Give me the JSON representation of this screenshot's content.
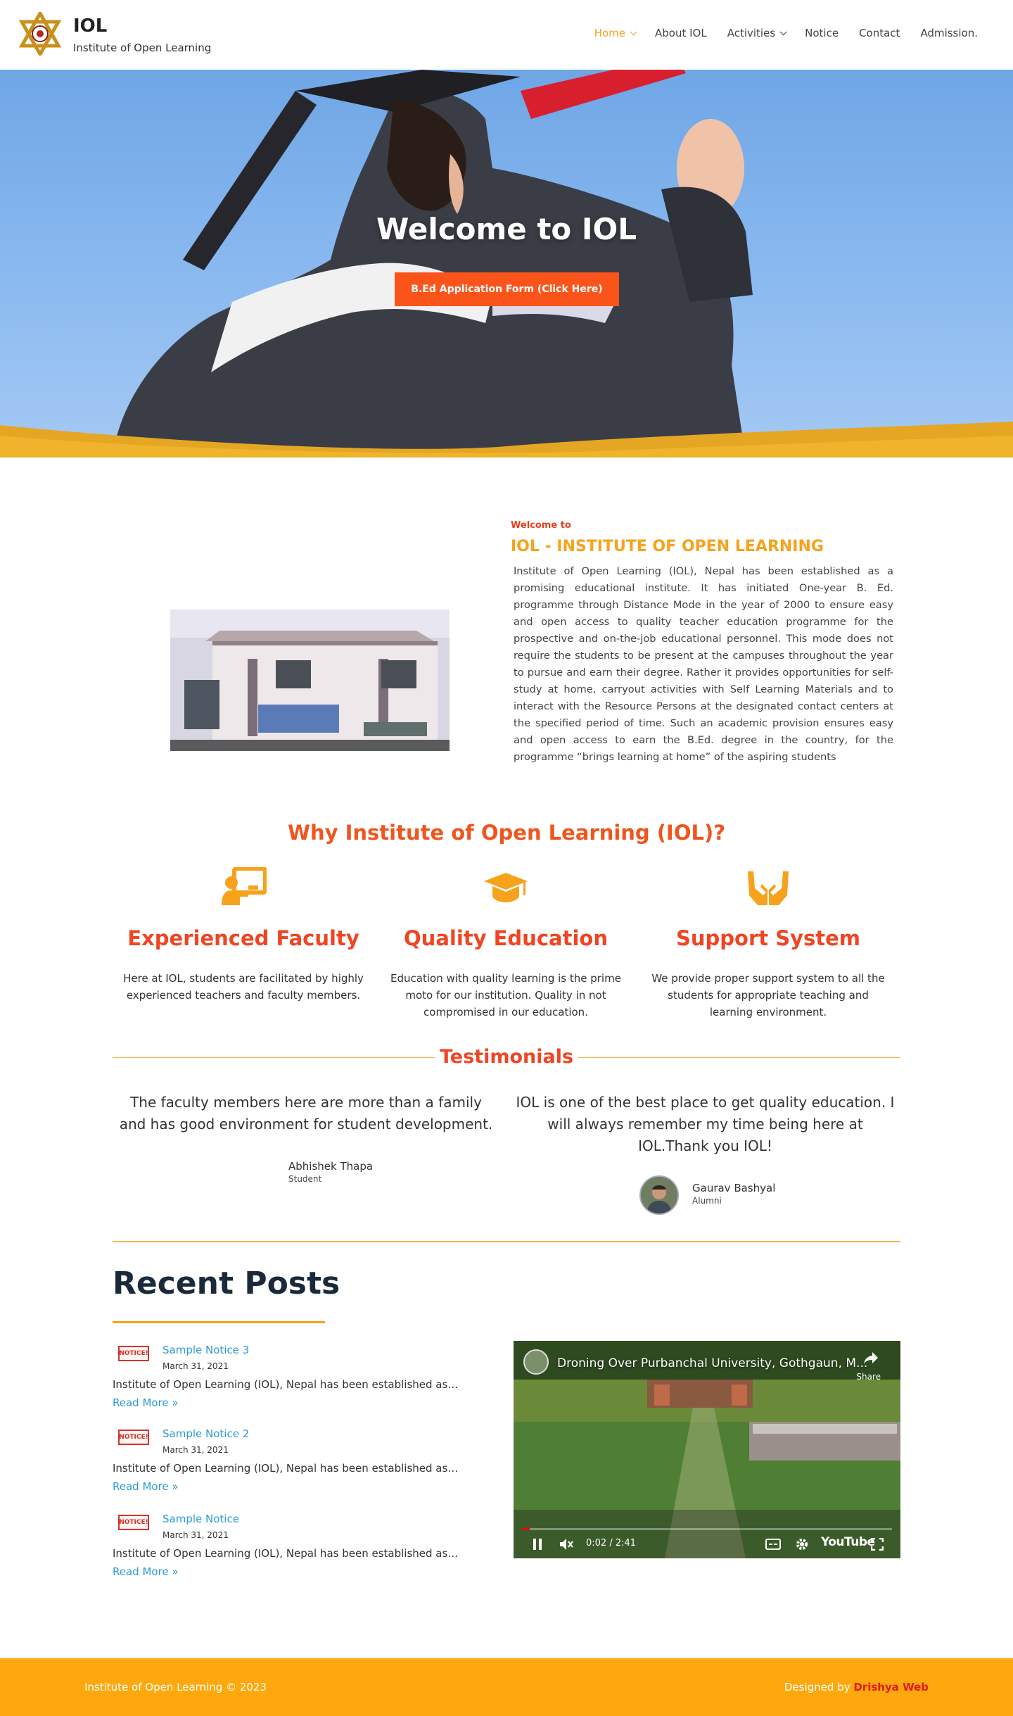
{
  "header": {
    "site_title": "IOL",
    "tagline": "Institute of Open Learning",
    "nav": [
      {
        "label": "Home",
        "has_dropdown": true,
        "active": true
      },
      {
        "label": "About IOL",
        "has_dropdown": false,
        "active": false
      },
      {
        "label": "Activities",
        "has_dropdown": true,
        "active": false
      },
      {
        "label": "Notice",
        "has_dropdown": false,
        "active": false
      },
      {
        "label": "Contact",
        "has_dropdown": false,
        "active": false
      },
      {
        "label": "Admission.",
        "has_dropdown": false,
        "active": false
      }
    ]
  },
  "hero": {
    "title": "Welcome to IOL",
    "cta_label": "B.Ed Application Form (Click Here)"
  },
  "about": {
    "kicker": "Welcome to",
    "heading": "IOL - INSTITUTE OF OPEN LEARNING",
    "body": "Institute of Open Learning (IOL), Nepal has been established as a promising educational institute. It has initiated One-year B. Ed. programme through Distance Mode in the year of 2000 to ensure easy and open access to quality teacher education programme for the prospective and on-the-job educational personnel. This mode does not require the students to be present at the campuses throughout the year to pursue and earn their degree. Rather it provides opportunities for self-study at home, carryout activities with Self Learning Materials and to interact with the Resource Persons at the designated contact centers at the specified period of time. Such an academic provision ensures easy and open access to earn the B.Ed. degree in the country, for the programme “brings learning at home” of the aspiring students"
  },
  "why": {
    "title": "Why Institute of Open Learning (IOL)?",
    "features": [
      {
        "icon": "teacher-board-icon",
        "title": "Experienced Faculty",
        "text": "Here at IOL, students are facilitated by highly experienced teachers and faculty members."
      },
      {
        "icon": "graduation-cap-icon",
        "title": "Quality Education",
        "text": "Education with quality learning is the prime moto for our institution. Quality in not compromised in our education."
      },
      {
        "icon": "support-hands-icon",
        "title": "Support System",
        "text": "We provide proper support system to all the students for appropriate teaching and learning environment."
      }
    ]
  },
  "testimonials": {
    "title": "Testimonials",
    "items": [
      {
        "quote": "The faculty members here are more than a family and has good environment for student development.",
        "name": "Abhishek Thapa",
        "role": "Student"
      },
      {
        "quote": "IOL is one of the best place to get quality education. I will always remember my time being here at IOL.Thank you IOL!",
        "name": "Gaurav Bashyal",
        "role": "Alumni"
      }
    ]
  },
  "recent_posts": {
    "title": "Recent Posts",
    "thumb_label": "NOTICE!",
    "read_more": "Read More »",
    "posts": [
      {
        "title": "Sample Notice 3",
        "date": "March 31, 2021",
        "excerpt": "Institute of Open Learning (IOL), Nepal has been established as…"
      },
      {
        "title": "Sample Notice 2",
        "date": "March 31, 2021",
        "excerpt": "Institute of Open Learning (IOL), Nepal has been established as…"
      },
      {
        "title": "Sample Notice",
        "date": "March 31, 2021",
        "excerpt": "Institute of Open Learning (IOL), Nepal has been established as…"
      }
    ]
  },
  "video": {
    "title": "Droning Over Purbanchal University, Gothgaun, M...",
    "share_label": "Share",
    "time": "0:02 / 2:41",
    "progress": 0.02,
    "platform": "YouTube"
  },
  "footer": {
    "copyright": "Institute of Open Learning © 2023",
    "designed_by": "Designed by",
    "designer": "Drishya Web"
  },
  "colors": {
    "accent_orange": "#f7a21b",
    "cta_orange": "#fb541b",
    "heading_red": "#ef4523",
    "link_blue": "#2a9bd6",
    "footer_bg": "#fea80d"
  }
}
